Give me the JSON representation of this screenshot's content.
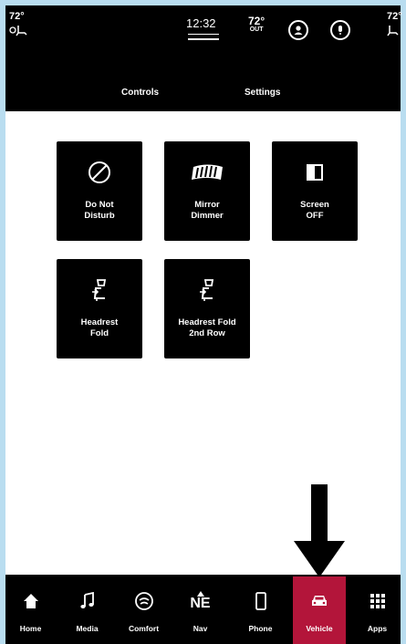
{
  "status": {
    "left_temp": "72°",
    "time": "12:32",
    "outside_temp": "72°",
    "outside_label": "OUT",
    "right_temp": "72°"
  },
  "tabs": [
    {
      "label": "Controls"
    },
    {
      "label": "Settings"
    }
  ],
  "tiles": [
    {
      "label_line1": "Do Not",
      "label_line2": "Disturb",
      "icon": "do-not-disturb-icon"
    },
    {
      "label_line1": "Mirror",
      "label_line2": "Dimmer",
      "icon": "mirror-dimmer-icon"
    },
    {
      "label_line1": "Screen",
      "label_line2": "OFF",
      "icon": "screen-off-icon"
    },
    {
      "label_line1": "Headrest",
      "label_line2": "Fold",
      "icon": "headrest-icon"
    },
    {
      "label_line1": "Headrest Fold",
      "label_line2": "2nd Row",
      "icon": "headrest-icon"
    }
  ],
  "nav": [
    {
      "label": "Home",
      "icon": "home-icon"
    },
    {
      "label": "Media",
      "icon": "music-note-icon"
    },
    {
      "label": "Comfort",
      "icon": "comfort-icon"
    },
    {
      "label": "Nav",
      "icon": "compass-icon",
      "heading": "NE"
    },
    {
      "label": "Phone",
      "icon": "phone-icon"
    },
    {
      "label": "Vehicle",
      "icon": "car-icon",
      "active": true
    },
    {
      "label": "Apps",
      "icon": "apps-grid-icon"
    }
  ],
  "colors": {
    "background": "#b9ddf0",
    "bars": "#000000",
    "content": "#ffffff",
    "active": "#b3153a"
  }
}
